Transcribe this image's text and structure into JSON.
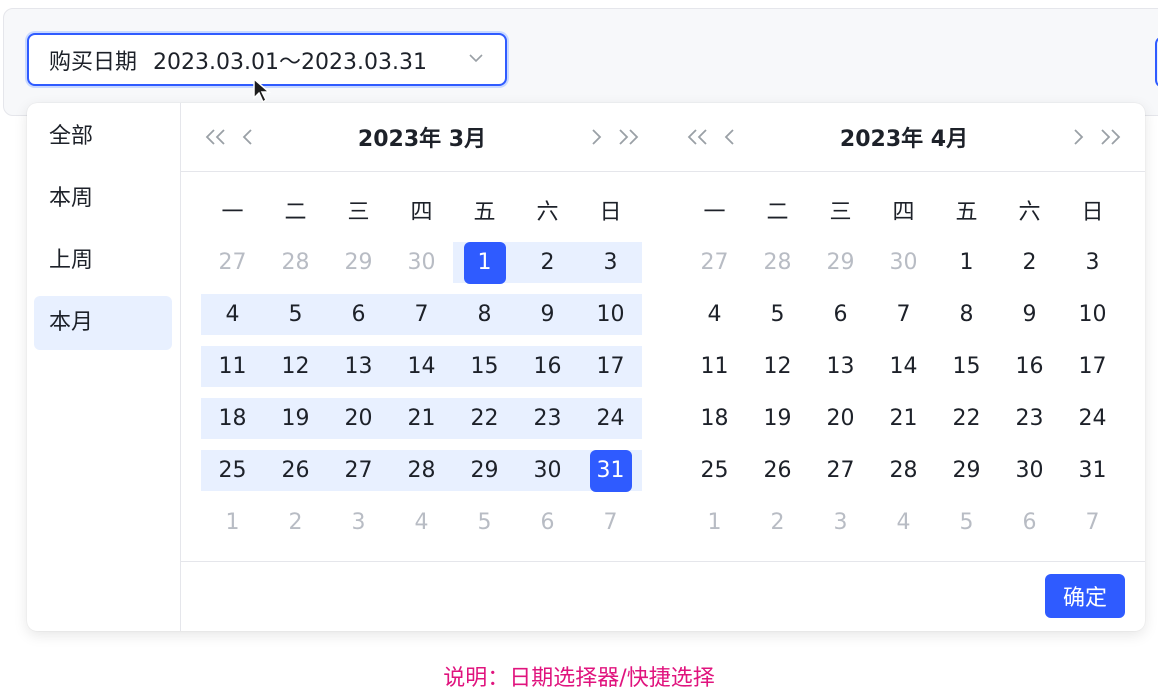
{
  "date_input": {
    "label": "购买日期",
    "value": "2023.03.01～2023.03.31"
  },
  "shortcuts": [
    {
      "label": "全部",
      "active": false
    },
    {
      "label": "本周",
      "active": false
    },
    {
      "label": "上周",
      "active": false
    },
    {
      "label": "本月",
      "active": true
    }
  ],
  "weekdays": [
    "一",
    "二",
    "三",
    "四",
    "五",
    "六",
    "日"
  ],
  "calendars": [
    {
      "title": "2023年 3月",
      "selection": {
        "start": 1,
        "end": 31
      },
      "weeks": [
        [
          "27",
          "28",
          "29",
          "30",
          "1",
          "2",
          "3"
        ],
        [
          "4",
          "5",
          "6",
          "7",
          "8",
          "9",
          "10"
        ],
        [
          "11",
          "12",
          "13",
          "14",
          "15",
          "16",
          "17"
        ],
        [
          "18",
          "19",
          "20",
          "21",
          "22",
          "23",
          "24"
        ],
        [
          "25",
          "26",
          "27",
          "28",
          "29",
          "30",
          "31"
        ],
        [
          "1",
          "2",
          "3",
          "4",
          "5",
          "6",
          "7"
        ]
      ],
      "muted": [
        [
          0,
          0
        ],
        [
          0,
          1
        ],
        [
          0,
          2
        ],
        [
          0,
          3
        ],
        [
          5,
          0
        ],
        [
          5,
          1
        ],
        [
          5,
          2
        ],
        [
          5,
          3
        ],
        [
          5,
          4
        ],
        [
          5,
          5
        ],
        [
          5,
          6
        ]
      ]
    },
    {
      "title": "2023年 4月",
      "selection": null,
      "weeks": [
        [
          "27",
          "28",
          "29",
          "30",
          "1",
          "2",
          "3"
        ],
        [
          "4",
          "5",
          "6",
          "7",
          "8",
          "9",
          "10"
        ],
        [
          "11",
          "12",
          "13",
          "14",
          "15",
          "16",
          "17"
        ],
        [
          "18",
          "19",
          "20",
          "21",
          "22",
          "23",
          "24"
        ],
        [
          "25",
          "26",
          "27",
          "28",
          "29",
          "30",
          "31"
        ],
        [
          "1",
          "2",
          "3",
          "4",
          "5",
          "6",
          "7"
        ]
      ],
      "muted": [
        [
          0,
          0
        ],
        [
          0,
          1
        ],
        [
          0,
          2
        ],
        [
          0,
          3
        ],
        [
          5,
          0
        ],
        [
          5,
          1
        ],
        [
          5,
          2
        ],
        [
          5,
          3
        ],
        [
          5,
          4
        ],
        [
          5,
          5
        ],
        [
          5,
          6
        ]
      ]
    }
  ],
  "confirm_label": "确定",
  "caption": "说明：日期选择器/快捷选择",
  "colors": {
    "accent": "#2f5bff",
    "range_bg": "#e8f0ff",
    "muted_text": "#b8bcc4",
    "caption": "#e0147e"
  }
}
